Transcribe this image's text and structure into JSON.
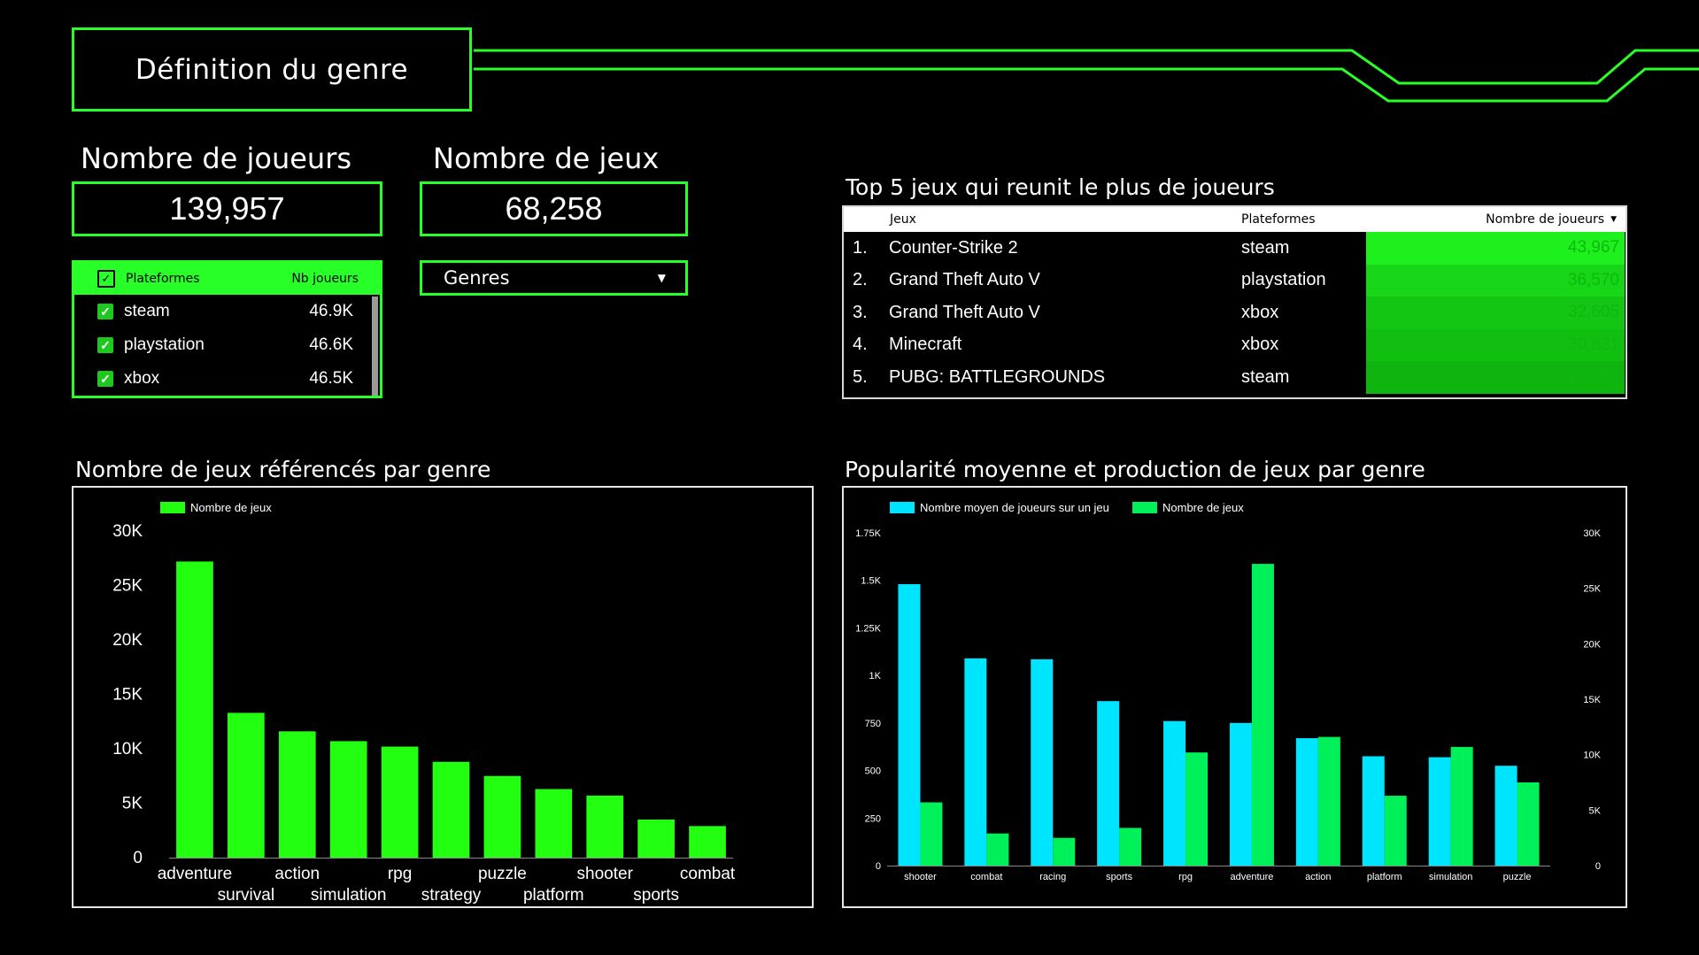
{
  "header": {
    "title": "Définition du genre"
  },
  "kpis": {
    "players_label": "Nombre de joueurs",
    "players_value": "139,957",
    "games_label": "Nombre de jeux",
    "games_value": "68,258"
  },
  "platform_table": {
    "col_platform": "Plateformes",
    "col_players": "Nb joueurs",
    "rows": [
      {
        "name": "steam",
        "value": "46.9K"
      },
      {
        "name": "playstation",
        "value": "46.6K"
      },
      {
        "name": "xbox",
        "value": "46.5K"
      }
    ]
  },
  "genre_filter": {
    "label": "Genres"
  },
  "top5": {
    "title": "Top 5 jeux qui reunit le plus de joueurs",
    "col_game": "Jeux",
    "col_platform": "Plateformes",
    "col_players": "Nombre de joueurs",
    "rows": [
      {
        "rank": "1.",
        "game": "Counter-Strike 2",
        "platform": "steam",
        "players": "43,967",
        "bg": "#1ef01e"
      },
      {
        "rank": "2.",
        "game": "Grand Theft Auto V",
        "platform": "playstation",
        "players": "36,570",
        "bg": "#17d617"
      },
      {
        "rank": "3.",
        "game": "Grand Theft Auto V",
        "platform": "xbox",
        "players": "32,605",
        "bg": "#13c613"
      },
      {
        "rank": "4.",
        "game": "Minecraft",
        "platform": "xbox",
        "players": "30,831",
        "bg": "#11bf11"
      },
      {
        "rank": "5.",
        "game": "PUBG: BATTLEGROUNDS",
        "platform": "steam",
        "players": "28,356",
        "bg": "#0fb40f"
      }
    ]
  },
  "colors": {
    "accent": "#28ff28",
    "bar_green": "#22ff10",
    "cyan": "#00e5ff",
    "green2": "#00f05a"
  },
  "chart_data": [
    {
      "type": "bar",
      "title": "Nombre de jeux référencés par genre",
      "legend": [
        "Nombre de jeux"
      ],
      "legend_position": "top-left",
      "categories": [
        "adventure",
        "survival",
        "action",
        "simulation",
        "rpg",
        "strategy",
        "puzzle",
        "platform",
        "shooter",
        "sports",
        "combat"
      ],
      "series": [
        {
          "name": "Nombre de jeux",
          "values": [
            27200,
            13300,
            11600,
            10700,
            10200,
            8800,
            7500,
            6300,
            5700,
            3500,
            2900
          ]
        }
      ],
      "yticks": [
        "0",
        "5K",
        "10K",
        "15K",
        "20K",
        "25K",
        "30K"
      ],
      "ylim": [
        0,
        30000
      ],
      "grid": false
    },
    {
      "type": "bar",
      "title": "Popularité moyenne et production de jeux par genre",
      "legend": [
        "Nombre moyen de joueurs sur un jeu",
        "Nombre de jeux"
      ],
      "legend_position": "top-left",
      "categories": [
        "shooter",
        "combat",
        "racing",
        "sports",
        "rpg",
        "adventure",
        "action",
        "platform",
        "simulation",
        "puzzle"
      ],
      "series": [
        {
          "name": "Nombre moyen de joueurs sur un jeu",
          "axis": "left",
          "values": [
            1480,
            1090,
            1085,
            865,
            760,
            750,
            670,
            575,
            570,
            525
          ]
        },
        {
          "name": "Nombre de jeux",
          "axis": "right",
          "values": [
            5700,
            2900,
            2500,
            3400,
            10200,
            27200,
            11600,
            6300,
            10700,
            7500
          ]
        }
      ],
      "y_left_ticks": [
        "0",
        "250",
        "500",
        "750",
        "1K",
        "1.25K",
        "1.5K",
        "1.75K"
      ],
      "y_left_lim": [
        0,
        1750
      ],
      "y_right_ticks": [
        "0",
        "5K",
        "10K",
        "15K",
        "20K",
        "25K",
        "30K"
      ],
      "y_right_lim": [
        0,
        30000
      ],
      "grid": false
    }
  ]
}
